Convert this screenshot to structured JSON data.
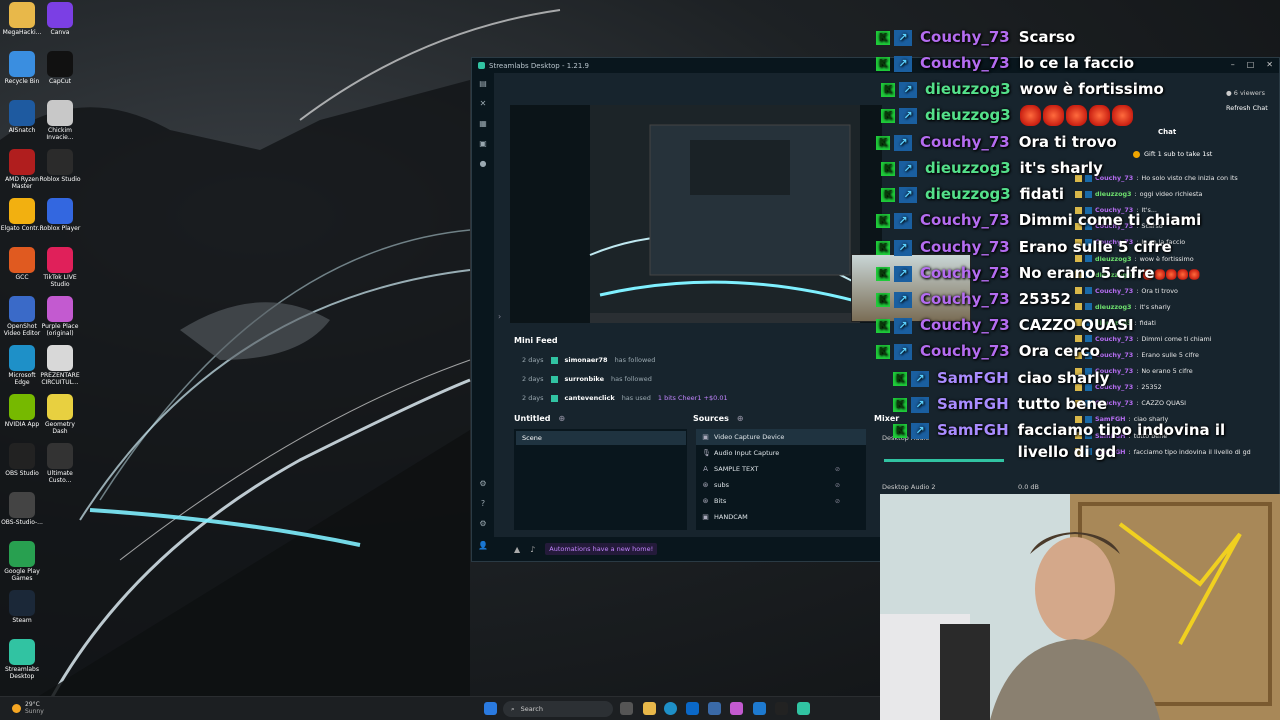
{
  "desktop": {
    "icons": [
      {
        "label": "MegaHacki...",
        "color": "#e8b84a"
      },
      {
        "label": "Canva",
        "color": "#7b3fe4"
      },
      {
        "label": "Recycle Bin",
        "color": "#3a8ee0"
      },
      {
        "label": "CapCut",
        "color": "#111111"
      },
      {
        "label": "AISnatch",
        "color": "#1e5aa0"
      },
      {
        "label": "Chickim Invacie...",
        "color": "#c8c8c8"
      },
      {
        "label": "AMD Ryzen Master",
        "color": "#b01e1e"
      },
      {
        "label": "Roblox Studio",
        "color": "#2b2b2b"
      },
      {
        "label": "Elgato Contr...",
        "color": "#f2b010"
      },
      {
        "label": "Roblox Player",
        "color": "#3367e0"
      },
      {
        "label": "GCC",
        "color": "#e05a20"
      },
      {
        "label": "TikTok LIVE Studio",
        "color": "#e0205a"
      },
      {
        "label": "OpenShot Video Editor",
        "color": "#3a6ac8"
      },
      {
        "label": "Purple Place (original)",
        "color": "#c35ad0"
      },
      {
        "label": "Microsoft Edge",
        "color": "#1e90c8"
      },
      {
        "label": "PREZENTARE CIRCUITUL...",
        "color": "#d8d8d8"
      },
      {
        "label": "NVIDIA App",
        "color": "#76b900"
      },
      {
        "label": "Geometry Dash",
        "color": "#e8d040"
      },
      {
        "label": "OBS Studio",
        "color": "#222222"
      },
      {
        "label": "Ultimate Custo...",
        "color": "#333333"
      },
      {
        "label": "OBS-Studio-...",
        "color": "#444444"
      },
      {
        "label": "Google Play Games",
        "color": "#28a050"
      },
      {
        "label": "Steam",
        "color": "#1b2838"
      },
      {
        "label": "Streamlabs Desktop",
        "color": "#31c3a2"
      }
    ]
  },
  "streamlabs": {
    "title": "Streamlabs Desktop - 1.21.9",
    "mini_feed": {
      "title": "Mini Feed",
      "rows": [
        {
          "time": "2 days",
          "user": "simonaer78",
          "action": "has followed",
          "extra": ""
        },
        {
          "time": "2 days",
          "user": "surronbike",
          "action": "has followed",
          "extra": ""
        },
        {
          "time": "2 days",
          "user": "cantevenclick",
          "action": "has used",
          "extra": "1 bits  Cheer1 +$0.01"
        }
      ]
    },
    "scenes": {
      "title": "Untitled",
      "items": [
        "Scene"
      ]
    },
    "sources": {
      "title": "Sources",
      "items": [
        "Video Capture Device",
        "Audio Input Capture",
        "SAMPLE TEXT",
        "subs",
        "Bits",
        "HANDCAM"
      ]
    },
    "mixer": {
      "title": "Mixer",
      "channel1": "Desktop Audio",
      "channel2": "Desktop Audio 2",
      "db2": "0.0 dB"
    },
    "footer_notice": "Automations have a new home!"
  },
  "chat_panel": {
    "viewers": "6 viewers",
    "refresh": "Refresh Chat",
    "header": "Chat",
    "gift": "Gift 1 sub to take 1st",
    "lines": [
      {
        "name": "Couchy_73",
        "color": "#b46cf0",
        "msg": "Ho solo visto che inizia con its"
      },
      {
        "name": "dieuzzog3",
        "color": "#6ee06e",
        "msg": "oggi video richiesta"
      },
      {
        "name": "Couchy_73",
        "color": "#b46cf0",
        "msg": "It's..."
      },
      {
        "name": "Couchy_73",
        "color": "#b46cf0",
        "msg": "Scarso"
      },
      {
        "name": "Couchy_73",
        "color": "#b46cf0",
        "msg": "lo ce la faccio"
      },
      {
        "name": "dieuzzog3",
        "color": "#6ee06e",
        "msg": "wow è fortissimo"
      },
      {
        "name": "dieuzzog3",
        "color": "#6ee06e",
        "msg": ""
      },
      {
        "name": "Couchy_73",
        "color": "#b46cf0",
        "msg": "Ora ti trovo"
      },
      {
        "name": "dieuzzog3",
        "color": "#6ee06e",
        "msg": "it's sharly"
      },
      {
        "name": "dieuzzog3",
        "color": "#6ee06e",
        "msg": "fidati"
      },
      {
        "name": "Couchy_73",
        "color": "#b46cf0",
        "msg": "Dimmi come ti chiami"
      },
      {
        "name": "Couchy_73",
        "color": "#b46cf0",
        "msg": "Erano sulle 5 cifre"
      },
      {
        "name": "Couchy_73",
        "color": "#b46cf0",
        "msg": "No erano 5 cifre"
      },
      {
        "name": "Couchy_73",
        "color": "#b46cf0",
        "msg": "25352"
      },
      {
        "name": "Couchy_73",
        "color": "#b46cf0",
        "msg": "CAZZO QUASI"
      },
      {
        "name": "SamFGH",
        "color": "#b46cf0",
        "msg": "ciao sharly"
      },
      {
        "name": "SamFGH",
        "color": "#b46cf0",
        "msg": "tutto bene"
      },
      {
        "name": "SamFGH",
        "color": "#b46cf0",
        "msg": "facciamo tipo indovina il livello di gd"
      }
    ]
  },
  "overlay_chat": [
    {
      "name": "Couchy_73",
      "color": "#b46cf0",
      "msg": "Scarso",
      "emoji": false
    },
    {
      "name": "Couchy_73",
      "color": "#b46cf0",
      "msg": "lo ce la faccio",
      "emoji": false
    },
    {
      "name": "dieuzzog3",
      "color": "#54e08a",
      "msg": "wow è fortissimo",
      "emoji": false
    },
    {
      "name": "dieuzzog3",
      "color": "#54e08a",
      "msg": "",
      "emoji": true
    },
    {
      "name": "Couchy_73",
      "color": "#b46cf0",
      "msg": "Ora ti trovo",
      "emoji": false
    },
    {
      "name": "dieuzzog3",
      "color": "#54e08a",
      "msg": "it's sharly",
      "emoji": false
    },
    {
      "name": "dieuzzog3",
      "color": "#54e08a",
      "msg": "fidati",
      "emoji": false
    },
    {
      "name": "Couchy_73",
      "color": "#b46cf0",
      "msg": "Dimmi come ti chiami",
      "emoji": false
    },
    {
      "name": "Couchy_73",
      "color": "#b46cf0",
      "msg": "Erano sulle 5 cifre",
      "emoji": false
    },
    {
      "name": "Couchy_73",
      "color": "#b46cf0",
      "msg": "No erano 5 cifre",
      "emoji": false
    },
    {
      "name": "Couchy_73",
      "color": "#b46cf0",
      "msg": "25352",
      "emoji": false
    },
    {
      "name": "Couchy_73",
      "color": "#b46cf0",
      "msg": "CAZZO QUASI",
      "emoji": false
    },
    {
      "name": "Couchy_73",
      "color": "#b46cf0",
      "msg": "Ora cerco",
      "emoji": false
    },
    {
      "name": "SamFGH",
      "color": "#a98cff",
      "msg": "ciao sharly",
      "emoji": false
    },
    {
      "name": "SamFGH",
      "color": "#a98cff",
      "msg": "tutto bene",
      "emoji": false
    },
    {
      "name": "SamFGH",
      "color": "#a98cff",
      "msg": "facciamo tipo indovina il livello di gd",
      "emoji": false
    }
  ],
  "taskbar": {
    "weather_temp": "29°C",
    "weather_desc": "Sunny",
    "search_placeholder": "Search"
  }
}
